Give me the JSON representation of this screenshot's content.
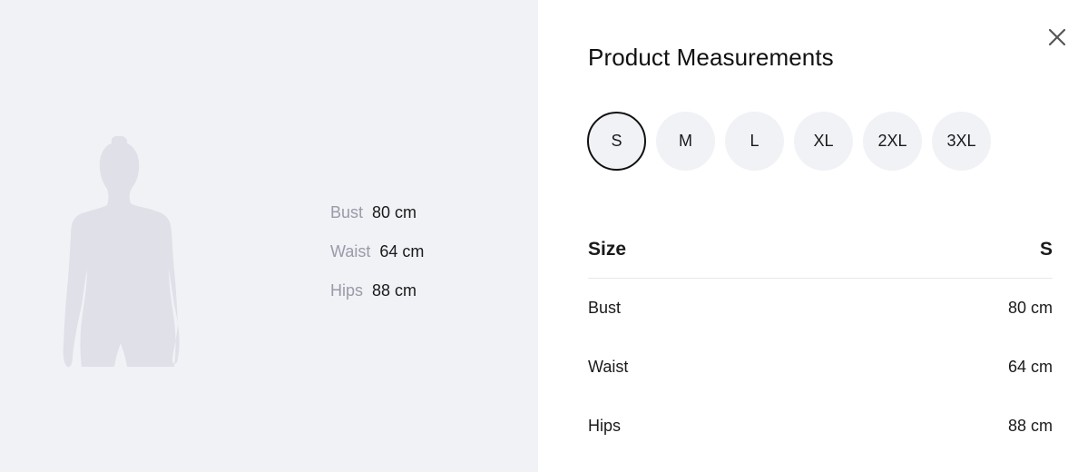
{
  "modal": {
    "title": "Product Measurements",
    "close_icon": "close-icon"
  },
  "figure": {
    "icon": "female-silhouette-icon",
    "measurements": [
      {
        "label": "Bust",
        "value": "80 cm"
      },
      {
        "label": "Waist",
        "value": "64 cm"
      },
      {
        "label": "Hips",
        "value": "88 cm"
      }
    ]
  },
  "sizes": {
    "options": [
      "S",
      "M",
      "L",
      "XL",
      "2XL",
      "3XL"
    ],
    "selected": "S"
  },
  "table": {
    "header": {
      "label": "Size",
      "value": "S"
    },
    "rows": [
      {
        "label": "Bust",
        "value": "80 cm"
      },
      {
        "label": "Waist",
        "value": "64 cm"
      },
      {
        "label": "Hips",
        "value": "88 cm"
      }
    ]
  },
  "colors": {
    "panel_bg": "#f1f2f6",
    "silhouette": "#dfe0e8",
    "label_muted": "#9a9aa8",
    "text": "#111111",
    "selected_border": "#111111"
  }
}
